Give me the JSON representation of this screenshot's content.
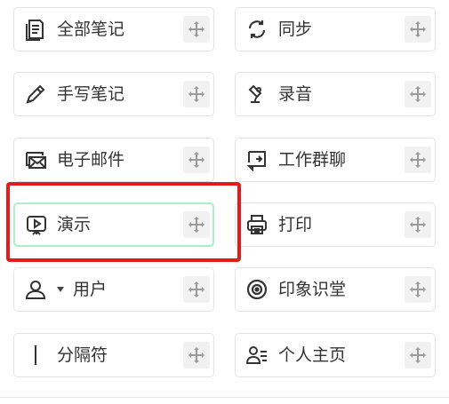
{
  "items": [
    {
      "id": "all-notes",
      "label": "全部笔记",
      "icon": "notes-icon"
    },
    {
      "id": "sync",
      "label": "同步",
      "icon": "sync-icon"
    },
    {
      "id": "handwrite",
      "label": "手写笔记",
      "icon": "pen-icon"
    },
    {
      "id": "audio",
      "label": "录音",
      "icon": "microphone-icon"
    },
    {
      "id": "email",
      "label": "电子邮件",
      "icon": "email-icon"
    },
    {
      "id": "workchat",
      "label": "工作群聊",
      "icon": "chat-icon"
    },
    {
      "id": "present",
      "label": "演示",
      "icon": "presentation-icon",
      "highlighted": true
    },
    {
      "id": "print",
      "label": "打印",
      "icon": "printer-icon"
    },
    {
      "id": "user",
      "label": "用户",
      "icon": "user-icon"
    },
    {
      "id": "yinxiang",
      "label": "印象识堂",
      "icon": "target-icon"
    },
    {
      "id": "separator",
      "label": "分隔符",
      "icon": "separator-icon"
    },
    {
      "id": "homepage",
      "label": "个人主页",
      "icon": "profile-icon"
    }
  ],
  "drag_icon": "move-icon",
  "colors": {
    "highlight_red": "#e31b1b",
    "selected_border": "#a6f2c6",
    "tile_border": "#e3e3e3"
  }
}
